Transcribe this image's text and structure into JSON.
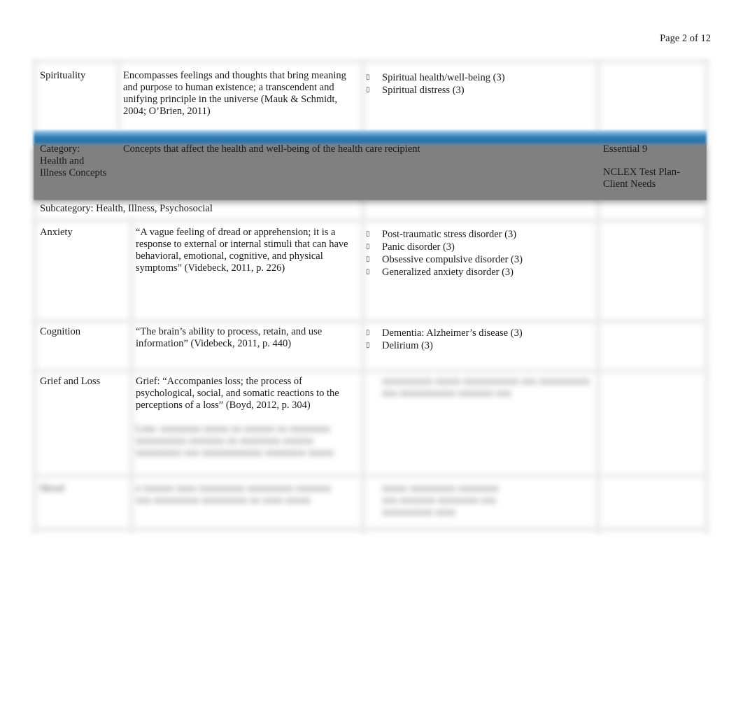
{
  "header": {
    "page_label": "Page 2 of 12"
  },
  "spirituality": {
    "concept": "Spirituality",
    "definition": "Encompasses feelings and thoughts that bring meaning and purpose to human existence; a transcendent and unifying principle in the universe (Mauk & Schmidt, 2004; O’Brien, 2011)",
    "exemplars": [
      "Spiritual health/well-being (3)",
      "Spiritual distress (3)"
    ]
  },
  "category_band": {
    "category_label": "Category:",
    "category_name_line1": "Health and",
    "category_name_line2": "Illness Concepts",
    "description": "Concepts that affect the health and well-being of the health care recipient",
    "essential": "Essential 9",
    "nclex_line1": "NCLEX Test Plan-",
    "nclex_line2": "Client Needs",
    "colors": {
      "blue": "#2a74ad",
      "gray": "#808080"
    }
  },
  "subcategory": "Subcategory: Health, Illness, Psychosocial",
  "rows": [
    {
      "concept": "Anxiety",
      "definition": "“A vague feeling of dread or apprehension; it is a response to external or internal stimuli that can have behavioral, emotional, cognitive, and physical symptoms” (Videbeck, 2011, p. 226)",
      "exemplars": [
        "Post-traumatic stress disorder (3)",
        "Panic disorder (3)",
        "Obsessive compulsive disorder (3)",
        "Generalized anxiety disorder (3)"
      ]
    },
    {
      "concept": "Cognition",
      "definition": "“The brain’s ability to process, retain, and use information” (Videbeck, 2011, p. 440)",
      "exemplars": [
        "Dementia: Alzheimer’s  disease (3)",
        "Delirium (3)"
      ]
    },
    {
      "concept": "Grief and Loss",
      "definition": "Grief: “Accompanies loss; the process of psychological, social, and somatic reactions to the perceptions of a loss” (Boyd, 2012, p. 304)",
      "definition_blurred": "Loss: xxxxxxxx xxxxx xx xxxxxx xx xxxxxxxx xxxxxxxxxx xxxxxxx xx xxxxxxxx xxxxxx xxxxxxxxx xxx xxxxxxxxxxxx xxxxxxxx xxxxx",
      "exemplars_blurred": "xxxxxxxxxx xxxxx xxxxxxxxxxx xxx xxxxxxxxxx xxx xxxxxxxxxxx xxxxxxx xxx"
    },
    {
      "concept_blurred": "Mood",
      "definition_blurred": "x xxxxxx xxxx xxxxxxxxx xxxxxxxxx xxxxxxx xxx xxxxxxxxx xxxxxxxxx xx xxxx xxxxx",
      "exemplars_blurred": "xxxxx xxxxxxxxx xxxxxxxx xxx xxxxxxx xxxxxxxx xxx xxxxxxxxxx xxxx"
    }
  ]
}
